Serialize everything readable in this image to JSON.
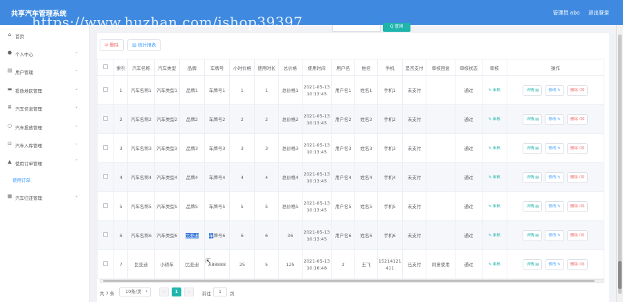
{
  "header": {
    "title": "共享汽车管理系统",
    "user_label": "管理员 abo",
    "logout_label": "退出登录",
    "watermark": "https://www.huzhan.com/ishop39397",
    "search_button": "Q 查询"
  },
  "sidebar": {
    "items": [
      {
        "icon": "home-icon",
        "label": "首页",
        "arrow": false
      },
      {
        "icon": "person-icon",
        "label": "个人中心",
        "arrow": true
      },
      {
        "icon": "users-icon",
        "label": "用户管理",
        "arrow": true
      },
      {
        "icon": "car-icon",
        "label": "投放地区管理",
        "arrow": true
      },
      {
        "icon": "list-icon",
        "label": "汽车信息管理",
        "arrow": true
      },
      {
        "icon": "clock-icon",
        "label": "汽车投放管理",
        "arrow": true
      },
      {
        "icon": "lock-icon",
        "label": "汽车入库管理",
        "arrow": true
      },
      {
        "icon": "user-icon",
        "label": "使用订单管理",
        "arrow": true
      },
      {
        "icon": "grid-icon",
        "label": "汽车归还管理",
        "arrow": true
      }
    ],
    "active_sub": "使用订单"
  },
  "toolbar": {
    "delete_label": "删除",
    "stats_label": "统计报表"
  },
  "table": {
    "headers": [
      "",
      "索引",
      "汽车名称",
      "汽车类型",
      "品牌",
      "车牌号",
      "小时价格",
      "使用时长",
      "总价格",
      "使用时间",
      "用户名",
      "姓名",
      "手机",
      "是否支付",
      "审核回复",
      "审核状态",
      "审核",
      "操作"
    ],
    "audit_label": "审核",
    "detail_label": "详情",
    "edit_label": "修改",
    "delete_label": "删除",
    "rows": [
      {
        "index": "1",
        "car_name": "汽车名称1",
        "car_type": "汽车类型1",
        "brand": "品牌1",
        "plate": "车牌号1",
        "hour_price": "1",
        "duration": "1",
        "total": "总价格1",
        "time": "2021-05-13 10:13:45",
        "username": "用户名1",
        "name": "姓名1",
        "phone": "手机1",
        "paid": "未支付",
        "reply": "",
        "status": "通过"
      },
      {
        "index": "2",
        "car_name": "汽车名称2",
        "car_type": "汽车类型2",
        "brand": "品牌2",
        "plate": "车牌号2",
        "hour_price": "2",
        "duration": "2",
        "total": "总价格2",
        "time": "2021-05-13 10:13:45",
        "username": "用户名2",
        "name": "姓名2",
        "phone": "手机2",
        "paid": "未支付",
        "reply": "",
        "status": "通过"
      },
      {
        "index": "3",
        "car_name": "汽车名称3",
        "car_type": "汽车类型3",
        "brand": "品牌3",
        "plate": "车牌号3",
        "hour_price": "3",
        "duration": "3",
        "total": "总价格3",
        "time": "2021-05-13 10:13:45",
        "username": "用户名3",
        "name": "姓名3",
        "phone": "手机3",
        "paid": "未支付",
        "reply": "",
        "status": "通过"
      },
      {
        "index": "4",
        "car_name": "汽车名称4",
        "car_type": "汽车类型4",
        "brand": "品牌4",
        "plate": "车牌号4",
        "hour_price": "4",
        "duration": "4",
        "total": "总价格4",
        "time": "2021-05-13 10:13:45",
        "username": "用户名4",
        "name": "姓名4",
        "phone": "手机4",
        "paid": "未支付",
        "reply": "",
        "status": "通过"
      },
      {
        "index": "5",
        "car_name": "汽车名称5",
        "car_type": "汽车类型5",
        "brand": "品牌5",
        "plate": "车牌号5",
        "hour_price": "5",
        "duration": "5",
        "total": "总价格5",
        "time": "2021-05-13 10:13:45",
        "username": "用户名5",
        "name": "姓名5",
        "phone": "手机5",
        "paid": "未支付",
        "reply": "",
        "status": "通过"
      },
      {
        "index": "6",
        "car_name": "汽车名称6",
        "car_type": "汽车类型6",
        "brand": "比亚迪",
        "plate": "车牌号6",
        "hour_price": "6",
        "duration": "6",
        "total": "36",
        "time": "2021-05-13 10:13:45",
        "username": "用户名6",
        "name": "姓名6",
        "phone": "手机6",
        "paid": "未支付",
        "reply": "",
        "status": "通过"
      },
      {
        "index": "7",
        "car_name": "比亚迪",
        "car_type": "小轿车",
        "brand": "比亚迪",
        "plate": "A88888",
        "hour_price": "25",
        "duration": "5",
        "total": "125",
        "time": "2021-05-13 10:16:48",
        "username": "2",
        "name": "王飞",
        "phone": "15214121411",
        "paid": "已支付",
        "reply": "同意使用",
        "status": "通过"
      }
    ]
  },
  "pagination": {
    "total": "共 7 条",
    "page_size": "10条/页",
    "current_page": "1",
    "goto_label": "前往",
    "goto_value": "1",
    "unit": "页",
    "prev": "‹",
    "next": "›"
  }
}
